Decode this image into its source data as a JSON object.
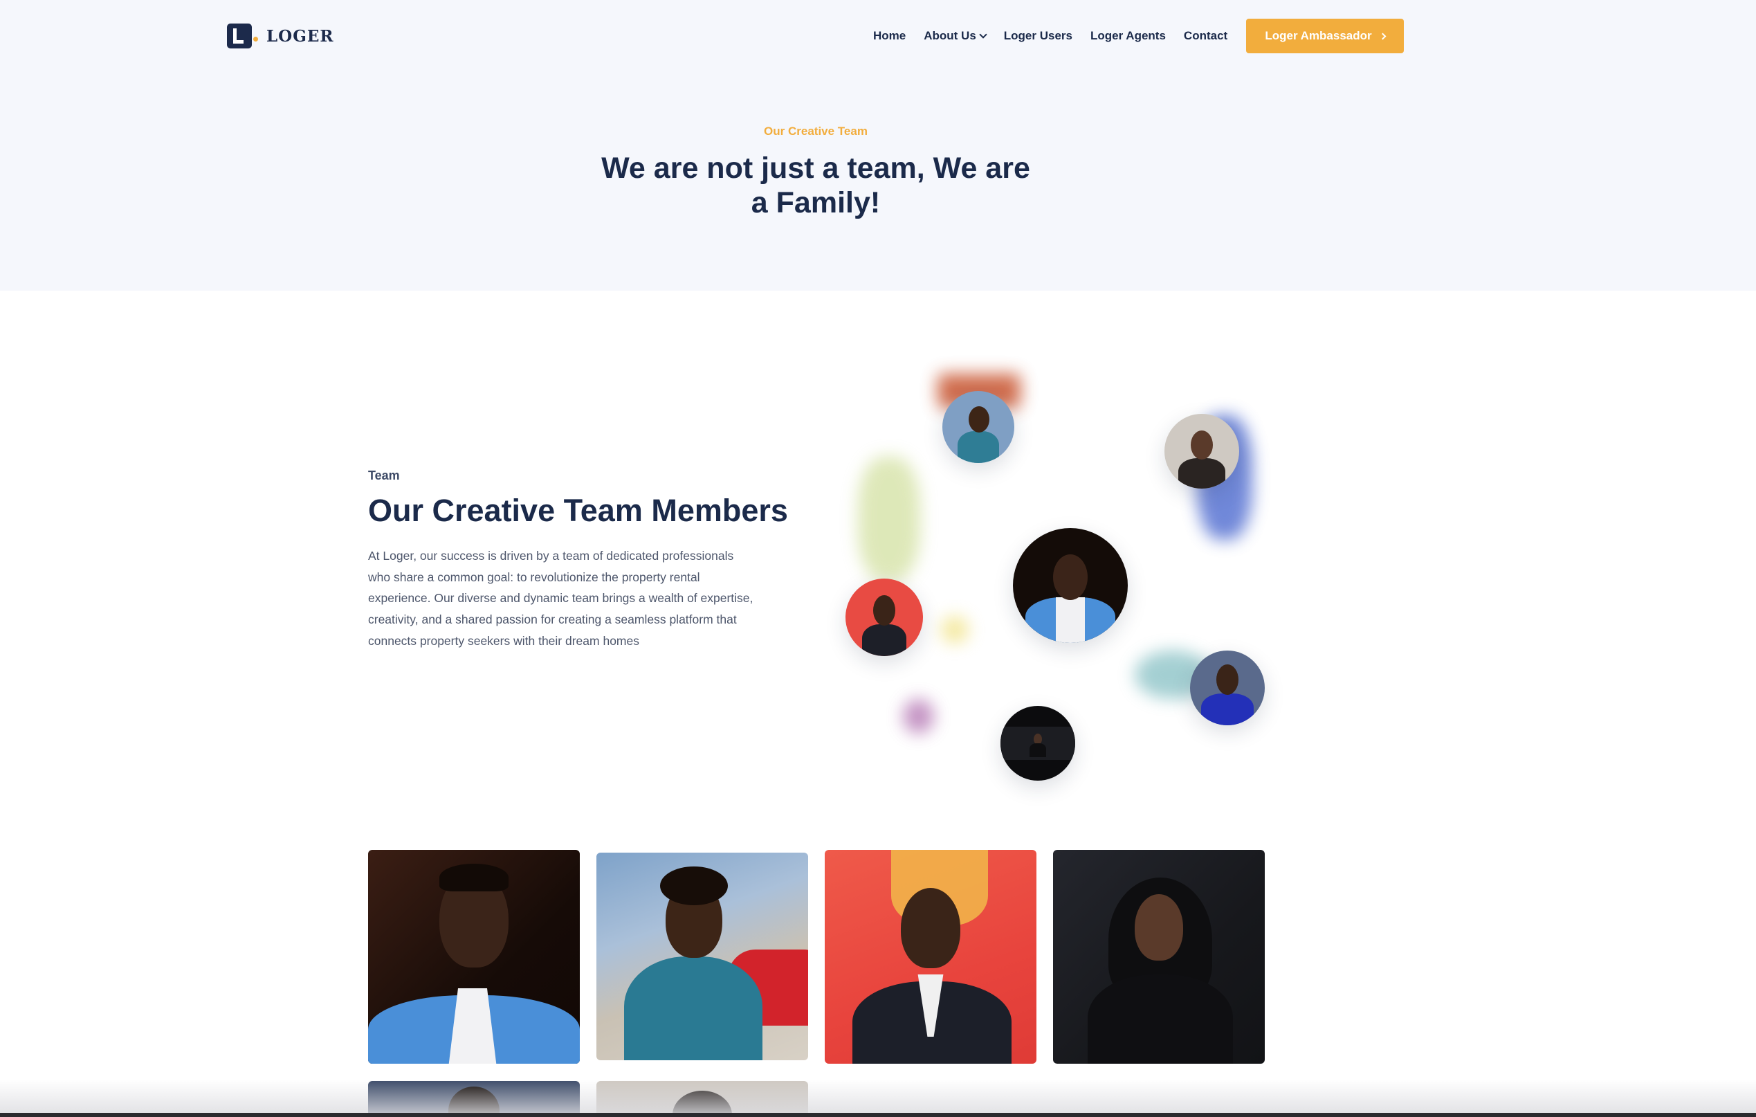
{
  "header": {
    "logo_text": "LOGER",
    "nav": [
      {
        "label": "Home"
      },
      {
        "label": "About Us",
        "has_dropdown": true
      },
      {
        "label": "Loger Users"
      },
      {
        "label": "Loger Agents"
      },
      {
        "label": "Contact"
      }
    ],
    "cta_label": "Loger Ambassador"
  },
  "hero": {
    "eyebrow": "Our Creative Team",
    "title": "We are not just a team, We are a Family!"
  },
  "team_intro": {
    "label": "Team",
    "title": "Our Creative Team Members",
    "description": "At Loger, our success is driven by a team of dedicated professionals who share a common goal: to revolutionize the property rental experience. Our diverse and dynamic team brings a wealth of expertise, creativity, and a shared passion for creating a seamless platform that connects property seekers with their dream homes"
  },
  "colors": {
    "accent": "#f2ad3d",
    "navy": "#1b2a4a",
    "hero_bg": "#f5f7fc"
  },
  "team_cluster": [
    {
      "name": "team-avatar-teal-shirt"
    },
    {
      "name": "team-avatar-woman-light"
    },
    {
      "name": "team-avatar-blue-blazer"
    },
    {
      "name": "team-avatar-red-backdrop"
    },
    {
      "name": "team-avatar-royal-blue-suit"
    },
    {
      "name": "team-avatar-dark-portrait"
    }
  ],
  "team_grid": [
    {
      "name": "team-photo-blue-blazer"
    },
    {
      "name": "team-photo-teal-shirt"
    },
    {
      "name": "team-photo-red-backdrop"
    },
    {
      "name": "team-photo-woman-black"
    },
    {
      "name": "team-photo-navy-partial"
    },
    {
      "name": "team-photo-light-partial"
    }
  ]
}
